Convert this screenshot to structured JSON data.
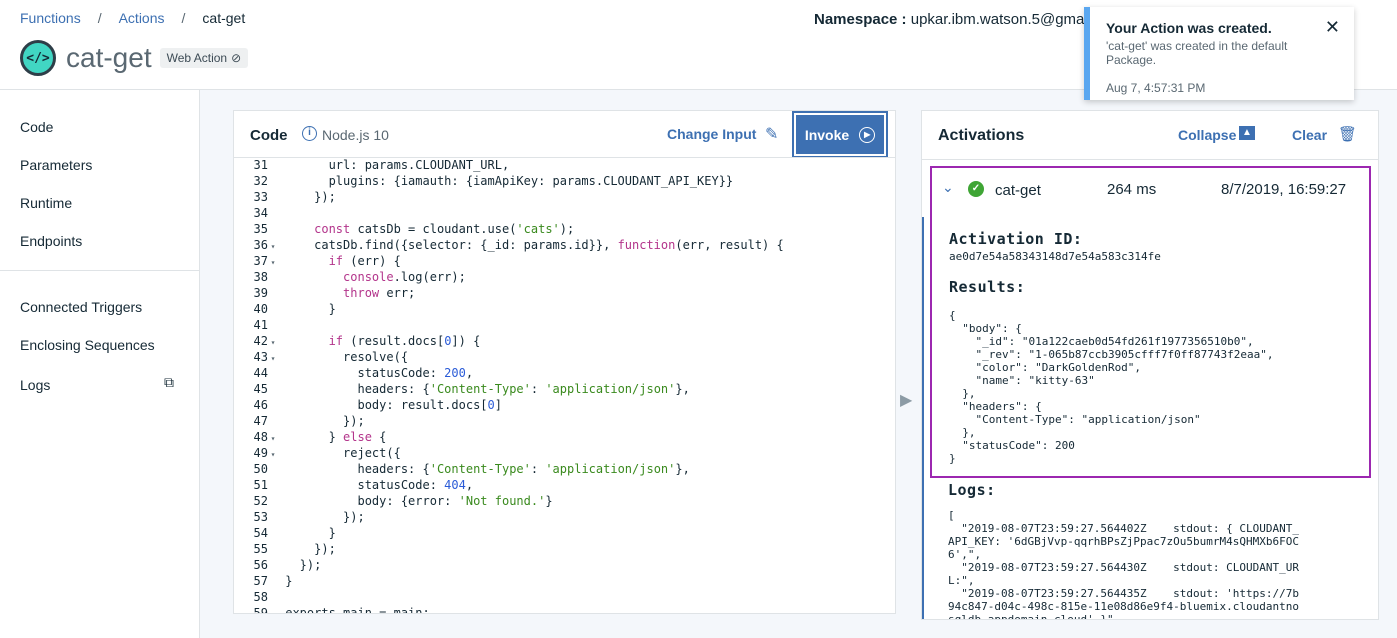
{
  "breadcrumb": {
    "items": [
      "Functions",
      "Actions"
    ],
    "current": "cat-get"
  },
  "header": {
    "logo_glyph": "</>",
    "title": "cat-get",
    "badge": "Web Action",
    "namespace_label": "Namespace :",
    "namespace_value": "upkar.ibm.watson.5@gma"
  },
  "toast": {
    "title": "Your Action was created.",
    "message": "'cat-get' was created in the default Package.",
    "time": "Aug 7, 4:57:31 PM",
    "close": "✕"
  },
  "sidebar": {
    "items": [
      "Code",
      "Parameters",
      "Runtime",
      "Endpoints"
    ],
    "items2": [
      "Connected Triggers",
      "Enclosing Sequences",
      "Logs"
    ]
  },
  "code_panel": {
    "title": "Code",
    "runtime": "Node.js 10",
    "change_input": "Change Input",
    "invoke": "Invoke"
  },
  "code_lines": [
    {
      "n": "31",
      "fold": "",
      "text": "      url: params.CLOUDANT_URL,"
    },
    {
      "n": "32",
      "fold": "",
      "text": "      plugins: {iamauth: {iamApiKey: params.CLOUDANT_API_KEY}}"
    },
    {
      "n": "33",
      "fold": "",
      "text": "    });"
    },
    {
      "n": "34",
      "fold": "",
      "text": ""
    },
    {
      "n": "35",
      "fold": "",
      "text": "    const catsDb = cloudant.use('cats');"
    },
    {
      "n": "36",
      "fold": "▾",
      "text": "    catsDb.find({selector: {_id: params.id}}, function(err, result) {"
    },
    {
      "n": "37",
      "fold": "▾",
      "text": "      if (err) {"
    },
    {
      "n": "38",
      "fold": "",
      "text": "        console.log(err);"
    },
    {
      "n": "39",
      "fold": "",
      "text": "        throw err;"
    },
    {
      "n": "40",
      "fold": "",
      "text": "      }"
    },
    {
      "n": "41",
      "fold": "",
      "text": ""
    },
    {
      "n": "42",
      "fold": "▾",
      "text": "      if (result.docs[0]) {"
    },
    {
      "n": "43",
      "fold": "▾",
      "text": "        resolve({"
    },
    {
      "n": "44",
      "fold": "",
      "text": "          statusCode: 200,"
    },
    {
      "n": "45",
      "fold": "",
      "text": "          headers: {'Content-Type': 'application/json'},"
    },
    {
      "n": "46",
      "fold": "",
      "text": "          body: result.docs[0]"
    },
    {
      "n": "47",
      "fold": "",
      "text": "        });"
    },
    {
      "n": "48",
      "fold": "▾",
      "text": "      } else {"
    },
    {
      "n": "49",
      "fold": "▾",
      "text": "        reject({"
    },
    {
      "n": "50",
      "fold": "",
      "text": "          headers: {'Content-Type': 'application/json'},"
    },
    {
      "n": "51",
      "fold": "",
      "text": "          statusCode: 404,"
    },
    {
      "n": "52",
      "fold": "",
      "text": "          body: {error: 'Not found.'}"
    },
    {
      "n": "53",
      "fold": "",
      "text": "        });"
    },
    {
      "n": "54",
      "fold": "",
      "text": "      }"
    },
    {
      "n": "55",
      "fold": "",
      "text": "    });"
    },
    {
      "n": "56",
      "fold": "",
      "text": "  });"
    },
    {
      "n": "57",
      "fold": "",
      "text": "}"
    },
    {
      "n": "58",
      "fold": "",
      "text": ""
    },
    {
      "n": "59",
      "fold": "",
      "text": "exports.main = main;"
    }
  ],
  "activations": {
    "title": "Activations",
    "collapse": "Collapse",
    "clear": "Clear",
    "item": {
      "name": "cat-get",
      "duration": "264 ms",
      "date": "8/7/2019, 16:59:27",
      "activation_id_label": "Activation ID:",
      "activation_id": "ae0d7e54a58343148d7e54a583c314fe",
      "results_label": "Results:",
      "results": "{\n  \"body\": {\n    \"_id\": \"01a122caeb0d54fd261f1977356510b0\",\n    \"_rev\": \"1-065b87ccb3905cfff7f0ff87743f2eaa\",\n    \"color\": \"DarkGoldenRod\",\n    \"name\": \"kitty-63\"\n  },\n  \"headers\": {\n    \"Content-Type\": \"application/json\"\n  },\n  \"statusCode\": 200\n}"
    },
    "logs_label": "Logs:",
    "logs": "[\n  \"2019-08-07T23:59:27.564402Z    stdout: { CLOUDANT_\nAPI_KEY: '6dGBjVvp-qqrhBPsZjPpac7zOu5bumrM4sQHMXb6FOC\n6',\",\n  \"2019-08-07T23:59:27.564430Z    stdout: CLOUDANT_UR\nL:\",\n  \"2019-08-07T23:59:27.564435Z    stdout: 'https://7b\n94c847-d04c-498c-815e-11e08d86e9f4-bluemix.cloudantno\nsqldb.appdomain.cloud' }\""
  }
}
